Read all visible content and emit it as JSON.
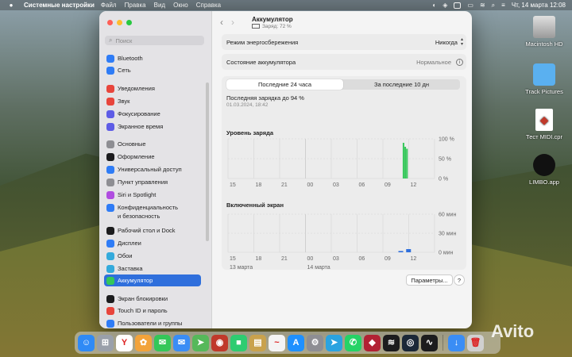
{
  "menubar": {
    "app": "Системные настройки",
    "items": [
      "Файл",
      "Правка",
      "Вид",
      "Окно",
      "Справка"
    ],
    "datetime": "Чт, 14 марта 12:08"
  },
  "desktop": {
    "icons": [
      {
        "label": "Macintosh HD",
        "icon": "hard-drive-icon"
      },
      {
        "label": "Track Pictures",
        "icon": "folder-icon"
      },
      {
        "label": "Тест MIDI.cpr",
        "icon": "cubase-document-icon"
      },
      {
        "label": "LIMBO.app",
        "icon": "limbo-app-icon"
      }
    ],
    "watermark": "Avito"
  },
  "sidebar": {
    "search_placeholder": "Поиск",
    "items": [
      {
        "label": "Bluetooth",
        "color": "#2f7cf6",
        "icon": "bluetooth-icon"
      },
      {
        "label": "Сеть",
        "color": "#2f7cf6",
        "icon": "globe-icon"
      },
      {
        "label": "Уведомления",
        "color": "#e8453c",
        "icon": "bell-icon"
      },
      {
        "label": "Звук",
        "color": "#e8453c",
        "icon": "speaker-icon"
      },
      {
        "label": "Фокусирование",
        "color": "#5e5ce6",
        "icon": "moon-icon"
      },
      {
        "label": "Экранное время",
        "color": "#5e5ce6",
        "icon": "hourglass-icon"
      },
      {
        "label": "Основные",
        "color": "#8e8e93",
        "icon": "gear-icon"
      },
      {
        "label": "Оформление",
        "color": "#1c1c1e",
        "icon": "appearance-icon"
      },
      {
        "label": "Универсальный доступ",
        "color": "#2f7cf6",
        "icon": "accessibility-icon"
      },
      {
        "label": "Пункт управления",
        "color": "#8e8e93",
        "icon": "control-center-icon"
      },
      {
        "label": "Siri и Spotlight",
        "color": "#b04de0",
        "icon": "siri-icon"
      },
      {
        "label": "Конфиденциальность",
        "color": "#2f7cf6",
        "icon": "hand-icon"
      },
      {
        "label": "и безопасность",
        "color": "",
        "icon": ""
      },
      {
        "label": "Рабочий стол и Dock",
        "color": "#1c1c1e",
        "icon": "dock-icon"
      },
      {
        "label": "Дисплеи",
        "color": "#2f7cf6",
        "icon": "display-icon"
      },
      {
        "label": "Обои",
        "color": "#34aadc",
        "icon": "wallpaper-icon"
      },
      {
        "label": "Заставка",
        "color": "#34aadc",
        "icon": "screensaver-icon"
      },
      {
        "label": "Аккумулятор",
        "color": "#34c759",
        "icon": "battery-icon"
      },
      {
        "label": "Экран блокировки",
        "color": "#1c1c1e",
        "icon": "lock-screen-icon"
      },
      {
        "label": "Touch ID и пароль",
        "color": "#e8453c",
        "icon": "fingerprint-icon"
      },
      {
        "label": "Пользователи и группы",
        "color": "#2f7cf6",
        "icon": "users-icon"
      }
    ],
    "selected_index": 17
  },
  "main": {
    "title": "Аккумулятор",
    "subtitle": "Заряд: 72 %",
    "low_power_label": "Режим энергосбережения",
    "low_power_value": "Никогда",
    "health_label": "Состояние аккумулятора",
    "health_value": "Нормальное",
    "tabs": [
      "Последние 24 часа",
      "За последние 10 дн"
    ],
    "last_charge": "Последняя зарядка до 94 %",
    "last_charge_date": "01.03.2024, 18:42",
    "params_button": "Параметры...",
    "help_button": "?"
  },
  "chart_data": [
    {
      "type": "bar",
      "title": "Уровень заряда",
      "x_ticks": [
        "15",
        "18",
        "21",
        "00",
        "03",
        "06",
        "09",
        "12"
      ],
      "y_ticks": [
        "100 %",
        "50 %",
        "0 %"
      ],
      "ylim": [
        0,
        100
      ],
      "bar_hours": [
        11.3,
        11.5,
        11.7
      ],
      "values": [
        90,
        80,
        75
      ],
      "color": "#34c759"
    },
    {
      "type": "bar",
      "title": "Включенный экран",
      "x_ticks": [
        "15",
        "18",
        "21",
        "00",
        "03",
        "06",
        "09",
        "12"
      ],
      "y_ticks": [
        "60 мин",
        "30 мин",
        "0 мин"
      ],
      "date_labels": [
        "13 марта",
        "14 марта"
      ],
      "ylim": [
        0,
        60
      ],
      "bar_hours": [
        10.8,
        11.7
      ],
      "values": [
        2,
        5
      ],
      "color": "#2f6fdc"
    }
  ],
  "dock": [
    {
      "name": "finder",
      "color": "#2f8af6",
      "glyph": "☺"
    },
    {
      "name": "launchpad",
      "color": "#9aa0aa",
      "glyph": "⊞"
    },
    {
      "name": "yandex-browser",
      "color": "#ffffff",
      "glyph": "Y"
    },
    {
      "name": "photos",
      "color": "#f2a33a",
      "glyph": "✿"
    },
    {
      "name": "messages",
      "color": "#34c759",
      "glyph": "✉"
    },
    {
      "name": "mail",
      "color": "#3a8df5",
      "glyph": "✉"
    },
    {
      "name": "maps",
      "color": "#56b85a",
      "glyph": "➤"
    },
    {
      "name": "photo-booth",
      "color": "#c0392b",
      "glyph": "◉"
    },
    {
      "name": "facetime",
      "color": "#2ecc71",
      "glyph": "■"
    },
    {
      "name": "notes",
      "color": "#c9a24d",
      "glyph": "▤"
    },
    {
      "name": "freeform",
      "color": "#f4f4f4",
      "glyph": "~"
    },
    {
      "name": "app-store",
      "color": "#1e90ff",
      "glyph": "A"
    },
    {
      "name": "system-settings",
      "color": "#8e8e93",
      "glyph": "⚙"
    },
    {
      "name": "telegram",
      "color": "#2aa3e0",
      "glyph": "➤"
    },
    {
      "name": "whatsapp",
      "color": "#25d366",
      "glyph": "✆"
    },
    {
      "name": "cubase",
      "color": "#b22234",
      "glyph": "◆"
    },
    {
      "name": "audio-app",
      "color": "#1c1c1e",
      "glyph": "≋"
    },
    {
      "name": "steam",
      "color": "#1b2838",
      "glyph": "◎"
    },
    {
      "name": "activity-monitor",
      "color": "#1c1c1e",
      "glyph": "∿"
    },
    {
      "name": "downloads",
      "color": "#3a8df5",
      "glyph": "↓"
    },
    {
      "name": "trash",
      "color": "#d0d0d0",
      "glyph": "🗑"
    }
  ]
}
